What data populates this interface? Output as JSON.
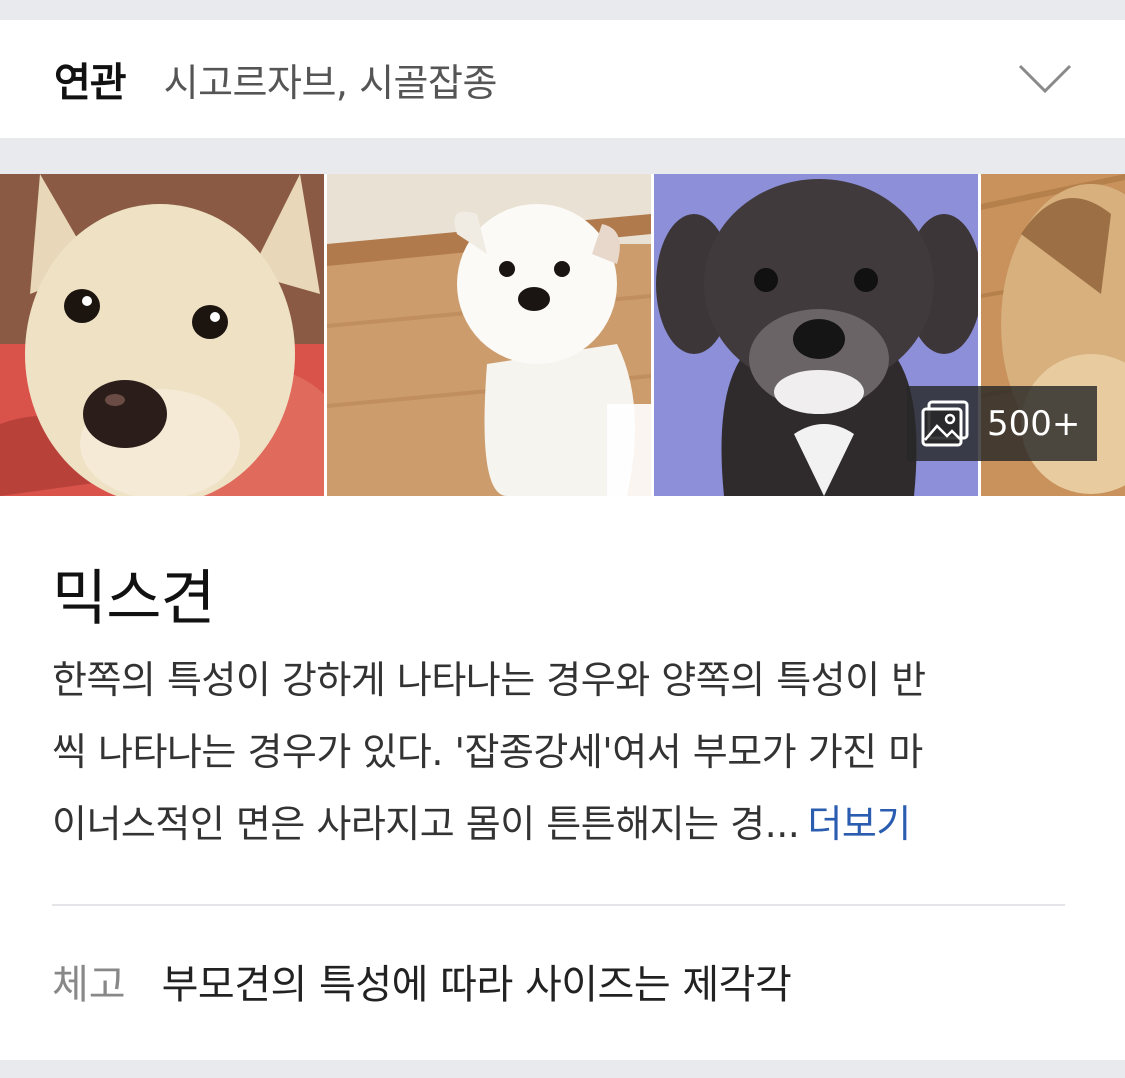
{
  "related": {
    "label": "연관",
    "terms": "시고르자브, 시골잡종",
    "expand_icon": "chevron-down-icon"
  },
  "gallery": {
    "photos": [
      {
        "name": "tan-dog-photo",
        "bg": "#c7876a"
      },
      {
        "name": "white-puppy-photo",
        "bg": "#c89a6b"
      },
      {
        "name": "schnauzer-mix-photo",
        "bg": "#8d8fd8"
      },
      {
        "name": "yorkie-photo",
        "bg": "#c58f5c"
      }
    ],
    "count_icon": "image-stack-icon",
    "count": "500+"
  },
  "entry": {
    "title": "믹스견",
    "desc_lines": [
      "한쪽의 특성이 강하게 나타나는 경우와 양쪽의 특성이 반",
      "씩 나타나는 경우가 있다. '잡종강세'여서 부모가 가진 마",
      "이너스적인 면은 사라지고 몸이 튼튼해지는 경..."
    ],
    "more_label": "더보기",
    "note_label": "체고",
    "note_text": "부모견의 특성에 따라 사이즈는 제각각"
  },
  "colors": {
    "link": "#2a5db0",
    "page_bg": "#e9eaee"
  }
}
